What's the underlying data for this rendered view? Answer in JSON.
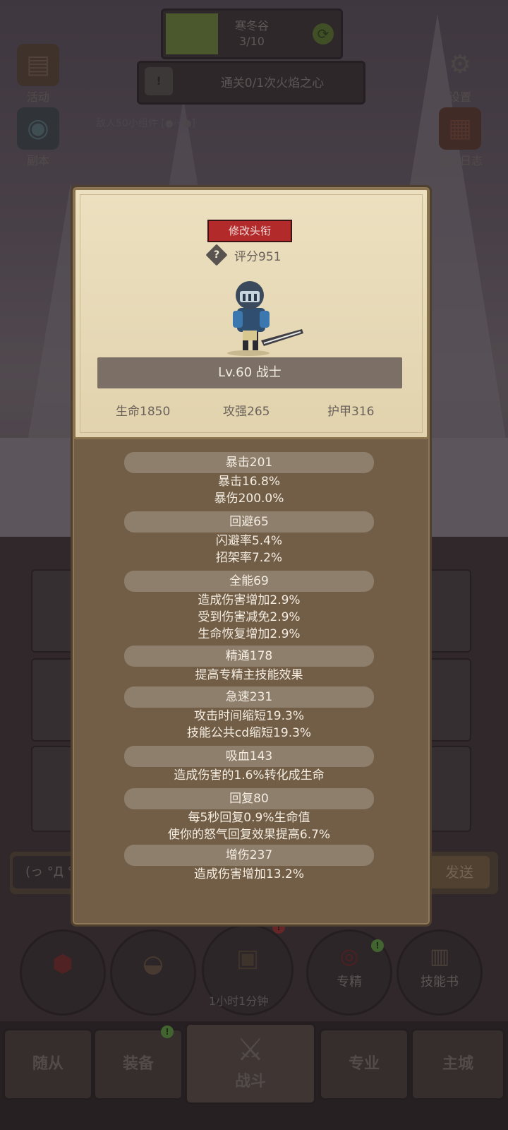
{
  "top": {
    "quest_title": "寒冬谷",
    "quest_progress": "3/10",
    "task_text": "通关0/1次火焰之心",
    "status_line": "敌人50小组件 [●···●]"
  },
  "side_buttons": {
    "activity": "活动",
    "dungeon": "副本",
    "settings": "设置",
    "journal": "旅行日志"
  },
  "modal": {
    "edit_title_button": "修改头衔",
    "score": "评分951",
    "level_class": "Lv.60 战士",
    "stats": {
      "hp": "生命1850",
      "attack": "攻强265",
      "armor": "护甲316"
    },
    "sections": [
      {
        "header": "暴击201",
        "lines": [
          "暴击16.8%",
          "暴伤200.0%"
        ]
      },
      {
        "header": "回避65",
        "lines": [
          "闪避率5.4%",
          "招架率7.2%"
        ]
      },
      {
        "header": "全能69",
        "lines": [
          "造成伤害增加2.9%",
          "受到伤害减免2.9%",
          "生命恢复增加2.9%"
        ]
      },
      {
        "header": "精通178",
        "lines": [
          "提高专精主技能效果"
        ]
      },
      {
        "header": "急速231",
        "lines": [
          "攻击时间缩短19.3%",
          "技能公共cd缩短19.3%"
        ]
      },
      {
        "header": "吸血143",
        "lines": [
          "造成伤害的1.6%转化成生命"
        ]
      },
      {
        "header": "回复80",
        "lines": [
          "每5秒回复0.9%生命值",
          "使你的怒气回复效果提高6.7%"
        ]
      },
      {
        "header": "增伤237",
        "lines": [
          "造成伤害增加13.2%"
        ]
      }
    ]
  },
  "chat": {
    "input_text": "(っ °Д °",
    "send_label": "发送"
  },
  "round_buttons": {
    "specialization": "专精",
    "skill_book": "技能书",
    "timer": "1小时1分钟"
  },
  "nav": {
    "followers": "随从",
    "equipment": "装备",
    "battle": "战斗",
    "profession": "专业",
    "main_city": "主城"
  },
  "colors": {
    "title_button": "#b22a2a",
    "parchment": "#e8dcbc",
    "panel_brown": "#725e46",
    "badge_green": "#5fa040"
  }
}
